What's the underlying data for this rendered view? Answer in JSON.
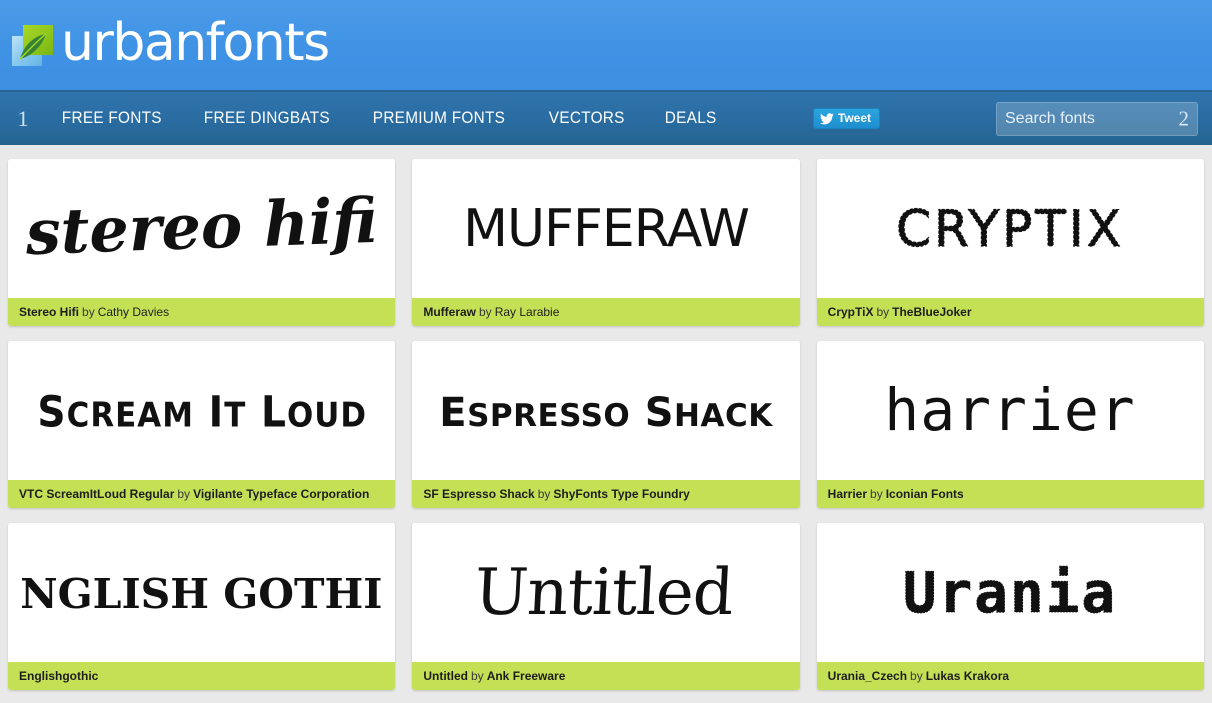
{
  "site": {
    "logo_text": "urbanfonts",
    "logo_icon": "leaf-square-logo"
  },
  "nav": {
    "marker": "1",
    "items": [
      {
        "label": "FREE FONTS",
        "name": "free-fonts"
      },
      {
        "label": "FREE DINGBATS",
        "name": "free-dingbats"
      },
      {
        "label": "PREMIUM FONTS",
        "name": "premium-fonts"
      },
      {
        "label": "VECTORS",
        "name": "vectors"
      },
      {
        "label": "DEALS",
        "name": "deals"
      }
    ],
    "tweet_label": "Tweet",
    "tweet_icon": "twitter-bird-icon",
    "search_placeholder": "Search fonts",
    "search_value": "",
    "search_marker": "2"
  },
  "colors": {
    "banner_blue": "#3f92e4",
    "nav_blue": "#2a6da3",
    "caption_green": "#c4e155",
    "page_bg": "#e9e9e9",
    "tweet_blue": "#1d8ecf"
  },
  "fonts": [
    {
      "preview_text": "stereo hifi",
      "name": "Stereo Hifi",
      "by": "by",
      "author": "Cathy Davies",
      "author_bold": false,
      "style": "script-brush"
    },
    {
      "preview_text": "MUFFERAW",
      "name": "Mufferaw",
      "by": "by",
      "author": "Ray Larabie",
      "author_bold": false,
      "style": "geometric-caps"
    },
    {
      "preview_text": "CRYPTIX",
      "name": "CrypTiX",
      "by": "by",
      "author": "TheBlueJoker",
      "author_bold": true,
      "style": "jagged-caps"
    },
    {
      "preview_text": "Scream It Loud",
      "name": "VTC ScreamItLoud Regular",
      "by": "by",
      "author": "Vigilante Typeface Corporation",
      "author_bold": true,
      "style": "bold-rounded-caps"
    },
    {
      "preview_text": "Espresso Shack",
      "name": "SF Espresso Shack",
      "by": "by",
      "author": "ShyFonts Type Foundry",
      "author_bold": true,
      "style": "condensed-smallcaps"
    },
    {
      "preview_text": "harrier",
      "name": "Harrier",
      "by": "by",
      "author": "Iconian Fonts",
      "author_bold": true,
      "style": "techno-lowercase"
    },
    {
      "preview_text": "ENGLISH GOTHIC",
      "name": "Englishgothic",
      "by": "",
      "author": "",
      "author_bold": false,
      "style": "uncial"
    },
    {
      "preview_text": "Untitled",
      "name": "Untitled",
      "by": "by",
      "author": "Ank Freeware",
      "author_bold": true,
      "style": "handwritten-quirky"
    },
    {
      "preview_text": "Urania",
      "name": "Urania_Czech",
      "by": "by",
      "author": "Lukas Krakora",
      "author_bold": true,
      "style": "typewriter-rough"
    }
  ]
}
